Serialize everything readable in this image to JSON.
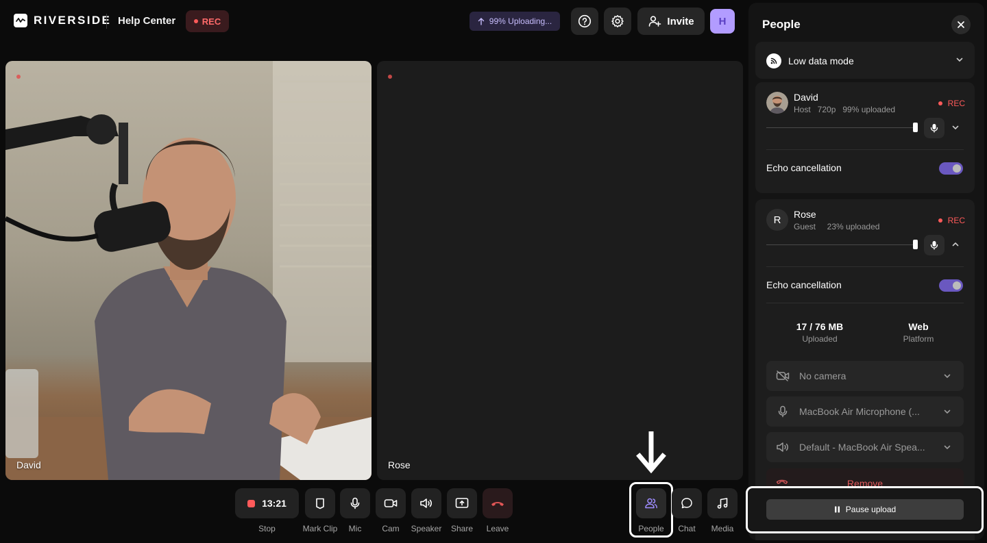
{
  "header": {
    "brand": "RIVERSIDE",
    "help_center": "Help Center",
    "rec_badge": "REC",
    "upload_status": "99% Uploading...",
    "invite_label": "Invite",
    "user_initial": "H"
  },
  "stage": {
    "tiles": [
      {
        "name": "David"
      },
      {
        "name": "Rose"
      }
    ]
  },
  "controls": {
    "timer": "13:21",
    "stop": "Stop",
    "mark_clip": "Mark Clip",
    "mic": "Mic",
    "cam": "Cam",
    "speaker": "Speaker",
    "share": "Share",
    "leave": "Leave",
    "people": "People",
    "chat": "Chat",
    "media": "Media"
  },
  "panel": {
    "title": "People",
    "low_data_mode": "Low data mode",
    "people": [
      {
        "name": "David",
        "meta": "Host   720p   99% uploaded",
        "rec": "REC",
        "echo_label": "Echo cancellation",
        "echo_on": true
      },
      {
        "name": "Rose",
        "initial": "R",
        "meta": "Guest     23% uploaded",
        "rec": "REC",
        "echo_label": "Echo cancellation",
        "echo_on": true,
        "uploaded_value": "17 / 76 MB",
        "uploaded_label": "Uploaded",
        "platform_value": "Web",
        "platform_label": "Platform",
        "camera": "No camera",
        "microphone": "MacBook Air Microphone (...",
        "speaker": "Default - MacBook Air Spea...",
        "remove": "Remove"
      }
    ],
    "pause_upload": "Pause upload"
  },
  "colors": {
    "accent": "#8c73ff",
    "rec": "#ff5a5a",
    "background": "#0b0b0b"
  }
}
